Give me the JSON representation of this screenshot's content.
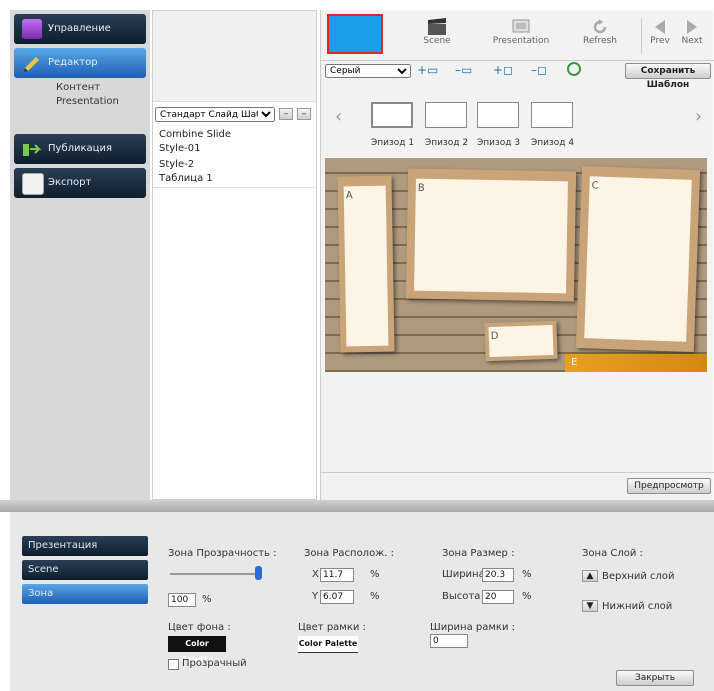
{
  "nav": {
    "items": [
      "Управление",
      "Редактор",
      "Публикация",
      "Экспорт"
    ],
    "subitems": [
      "Контент",
      "Presentation"
    ]
  },
  "list": {
    "dropdown": "Стандарт Слайд Шаблон",
    "items": [
      "Combine Slide",
      "Style-01",
      "Style-2",
      "Таблица 1"
    ]
  },
  "toolbar": {
    "scene": "Scene",
    "presentation": "Presentation",
    "refresh": "Refresh",
    "prev": "Prev",
    "next": "Next"
  },
  "editor": {
    "layout_select": "Серый",
    "save_template": "Сохранить Шаблон",
    "thumbnails": [
      "Эпизод 1",
      "Эпизод 2",
      "Эпизод 3",
      "Эпизод 4"
    ],
    "preview": "Предпросмотр",
    "zones": [
      "A",
      "B",
      "C",
      "D",
      "E"
    ]
  },
  "bottom": {
    "tabs": [
      "Презентация",
      "Scene",
      "Зона"
    ],
    "transparency_title": "Зона Прозрачность :",
    "transparency_value": "100",
    "transparency_unit": "%",
    "position_title": "Зона Располож. :",
    "pos_x_label": "X",
    "pos_x_value": "11.7",
    "pos_y_label": "Y",
    "pos_y_value": "6.07",
    "pos_unit": "%",
    "size_title": "Зона Размер :",
    "width_label": "Ширина",
    "width_value": "20.3",
    "height_label": "Высота",
    "height_value": "20",
    "size_unit": "%",
    "layer_title": "Зона Слой :",
    "layer_up": "Верхний слой",
    "layer_down": "Нижний слой",
    "bg_color_title": "Цвет фона :",
    "bg_color_btn": "Color Palette",
    "transparent_label": "Прозрачный",
    "frame_color_title": "Цвет рамки :",
    "frame_color_btn": "Color Palette",
    "frame_width_title": "Ширина рамки :",
    "frame_width_value": "0",
    "apply": "Закрыть"
  },
  "colors": {
    "accent": "#1c9fe8",
    "nav_dark": "#0e1e2e",
    "nav_active": "#2f7fd0"
  }
}
